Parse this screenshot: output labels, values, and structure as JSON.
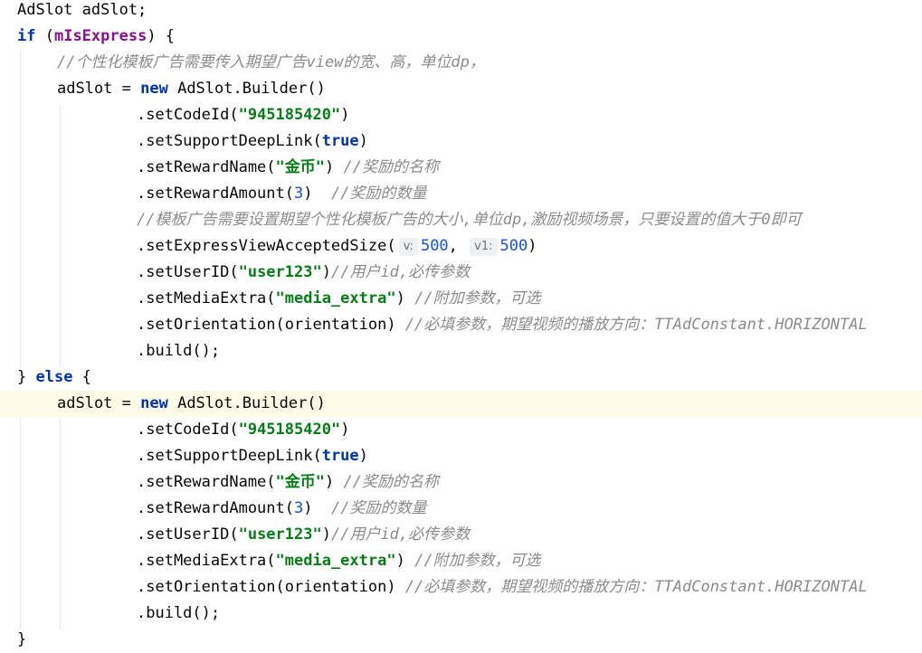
{
  "editor": {
    "lines": [
      {
        "indent": 0,
        "highlight": false,
        "tokens": [
          {
            "t": "AdSlot adSlot;",
            "c": ""
          }
        ]
      },
      {
        "indent": 0,
        "highlight": false,
        "tokens": [
          {
            "t": "if",
            "c": "kw"
          },
          {
            "t": " (",
            "c": ""
          },
          {
            "t": "mIsExpress",
            "c": "field"
          },
          {
            "t": ") {",
            "c": ""
          }
        ]
      },
      {
        "indent": 1,
        "highlight": false,
        "tokens": [
          {
            "t": "//个性化模板广告需要传入期望广告view的宽、高，单位dp，",
            "c": "cm"
          }
        ]
      },
      {
        "indent": 1,
        "highlight": false,
        "tokens": [
          {
            "t": "adSlot = ",
            "c": ""
          },
          {
            "t": "new",
            "c": "kw"
          },
          {
            "t": " AdSlot.Builder()",
            "c": ""
          }
        ]
      },
      {
        "indent": 3,
        "highlight": false,
        "tokens": [
          {
            "t": ".setCodeId(",
            "c": ""
          },
          {
            "t": "\"945185420\"",
            "c": "str"
          },
          {
            "t": ")",
            "c": ""
          }
        ]
      },
      {
        "indent": 3,
        "highlight": false,
        "tokens": [
          {
            "t": ".setSupportDeepLink(",
            "c": ""
          },
          {
            "t": "true",
            "c": "kw"
          },
          {
            "t": ")",
            "c": ""
          }
        ]
      },
      {
        "indent": 3,
        "highlight": false,
        "tokens": [
          {
            "t": ".setRewardName(",
            "c": ""
          },
          {
            "t": "\"金币\"",
            "c": "str"
          },
          {
            "t": ") ",
            "c": ""
          },
          {
            "t": "//奖励的名称",
            "c": "cm"
          }
        ]
      },
      {
        "indent": 3,
        "highlight": false,
        "tokens": [
          {
            "t": ".setRewardAmount(",
            "c": ""
          },
          {
            "t": "3",
            "c": "num"
          },
          {
            "t": ")  ",
            "c": ""
          },
          {
            "t": "//奖励的数量",
            "c": "cm"
          }
        ]
      },
      {
        "indent": 3,
        "highlight": false,
        "tokens": [
          {
            "t": "//模板广告需要设置期望个性化模板广告的大小,单位dp,激励视频场景，只要设置的值大于0即可",
            "c": "cm"
          }
        ]
      },
      {
        "indent": 3,
        "highlight": false,
        "tokens": [
          {
            "t": ".setExpressViewAcceptedSize(",
            "c": ""
          },
          {
            "t": "v:",
            "c": "hint"
          },
          {
            "t": "500",
            "c": "num"
          },
          {
            "t": ", ",
            "c": ""
          },
          {
            "t": "v1:",
            "c": "hint"
          },
          {
            "t": "500",
            "c": "num"
          },
          {
            "t": ")",
            "c": ""
          }
        ]
      },
      {
        "indent": 3,
        "highlight": false,
        "tokens": [
          {
            "t": ".setUserID(",
            "c": ""
          },
          {
            "t": "\"user123\"",
            "c": "str"
          },
          {
            "t": ")",
            "c": ""
          },
          {
            "t": "//用户id,必传参数",
            "c": "cm"
          }
        ]
      },
      {
        "indent": 3,
        "highlight": false,
        "tokens": [
          {
            "t": ".setMediaExtra(",
            "c": ""
          },
          {
            "t": "\"media_extra\"",
            "c": "str"
          },
          {
            "t": ") ",
            "c": ""
          },
          {
            "t": "//附加参数，可选",
            "c": "cm"
          }
        ]
      },
      {
        "indent": 3,
        "highlight": false,
        "tokens": [
          {
            "t": ".setOrientation(orientation) ",
            "c": ""
          },
          {
            "t": "//必填参数，期望视频的播放方向：TTAdConstant.HORIZONTAL",
            "c": "cm"
          }
        ]
      },
      {
        "indent": 3,
        "highlight": false,
        "tokens": [
          {
            "t": ".build();",
            "c": ""
          }
        ]
      },
      {
        "indent": 0,
        "highlight": false,
        "tokens": [
          {
            "t": "} ",
            "c": ""
          },
          {
            "t": "else",
            "c": "kw"
          },
          {
            "t": " {",
            "c": ""
          }
        ]
      },
      {
        "indent": 1,
        "highlight": true,
        "tokens": [
          {
            "t": "adSlot = ",
            "c": ""
          },
          {
            "t": "new",
            "c": "kw"
          },
          {
            "t": " AdSlot.Builder()",
            "c": ""
          }
        ]
      },
      {
        "indent": 3,
        "highlight": false,
        "tokens": [
          {
            "t": ".setCodeId(",
            "c": ""
          },
          {
            "t": "\"945185420\"",
            "c": "str"
          },
          {
            "t": ")",
            "c": ""
          }
        ]
      },
      {
        "indent": 3,
        "highlight": false,
        "tokens": [
          {
            "t": ".setSupportDeepLink(",
            "c": ""
          },
          {
            "t": "true",
            "c": "kw"
          },
          {
            "t": ")",
            "c": ""
          }
        ]
      },
      {
        "indent": 3,
        "highlight": false,
        "tokens": [
          {
            "t": ".setRewardName(",
            "c": ""
          },
          {
            "t": "\"金币\"",
            "c": "str"
          },
          {
            "t": ") ",
            "c": ""
          },
          {
            "t": "//奖励的名称",
            "c": "cm"
          }
        ]
      },
      {
        "indent": 3,
        "highlight": false,
        "tokens": [
          {
            "t": ".setRewardAmount(",
            "c": ""
          },
          {
            "t": "3",
            "c": "num"
          },
          {
            "t": ")  ",
            "c": ""
          },
          {
            "t": "//奖励的数量",
            "c": "cm"
          }
        ]
      },
      {
        "indent": 3,
        "highlight": false,
        "tokens": [
          {
            "t": ".setUserID(",
            "c": ""
          },
          {
            "t": "\"user123\"",
            "c": "str"
          },
          {
            "t": ")",
            "c": ""
          },
          {
            "t": "//用户id,必传参数",
            "c": "cm"
          }
        ]
      },
      {
        "indent": 3,
        "highlight": false,
        "tokens": [
          {
            "t": ".setMediaExtra(",
            "c": ""
          },
          {
            "t": "\"media_extra\"",
            "c": "str"
          },
          {
            "t": ") ",
            "c": ""
          },
          {
            "t": "//附加参数，可选",
            "c": "cm"
          }
        ]
      },
      {
        "indent": 3,
        "highlight": false,
        "tokens": [
          {
            "t": ".setOrientation(orientation) ",
            "c": ""
          },
          {
            "t": "//必填参数，期望视频的播放方向：TTAdConstant.HORIZONTAL",
            "c": "cm"
          }
        ]
      },
      {
        "indent": 3,
        "highlight": false,
        "tokens": [
          {
            "t": ".build();",
            "c": ""
          }
        ]
      },
      {
        "indent": 0,
        "highlight": false,
        "tokens": [
          {
            "t": "}",
            "c": ""
          }
        ]
      }
    ]
  },
  "colors": {
    "keyword": "#0033b3",
    "field": "#871094",
    "string": "#067d17",
    "number": "#1750eb",
    "comment": "#8c8c8c",
    "current_line": "#fdfbe8",
    "indent_guide": "#e6e6e6"
  }
}
